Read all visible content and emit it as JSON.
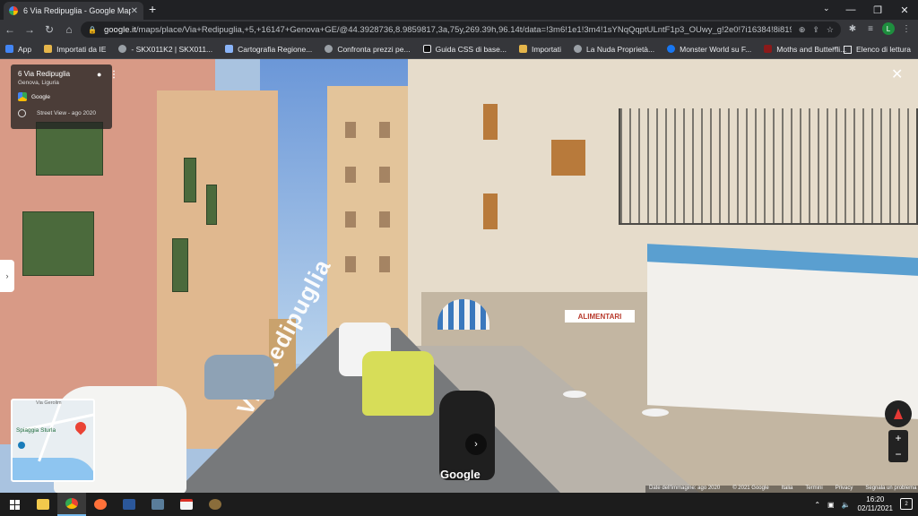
{
  "browser": {
    "tab_title": "6 Via Redipuglia - Google Maps",
    "new_tab": "+",
    "url_host": "google.it",
    "url_path": "/maps/place/Via+Redipuglia,+5,+16147+Genova+GE/@44.3928736,8.9859817,3a,75y,269.39h,96.14t/data=!3m6!1e1!3m4!1sYNqQqptULntF1p3_OUwy_g!2e0!7i16384!8i8192!4m5!3m4!1s0x12d3...",
    "profile_initial": "L",
    "window_controls": [
      "—",
      "❐",
      "✕"
    ]
  },
  "bookmarks": [
    {
      "label": "App",
      "color": "#4285f4"
    },
    {
      "label": "Importati da IE",
      "color": "#e5b54a"
    },
    {
      "label": "- SKX011K2 | SKX011...",
      "color": "#9aa0a6"
    },
    {
      "label": "Cartografia Regione...",
      "color": "#8ab4f8"
    },
    {
      "label": "Confronta prezzi pe...",
      "color": "#9aa0a6"
    },
    {
      "label": "Guida CSS di base...",
      "color": "#202124"
    },
    {
      "label": "Importati",
      "color": "#e5b54a"
    },
    {
      "label": "La Nuda Proprietà...",
      "color": "#9aa0a6"
    },
    {
      "label": "Monster World su F...",
      "color": "#1877f2"
    },
    {
      "label": "Moths and Butterfli...",
      "color": "#8b1a1a"
    }
  ],
  "reading_list": "Elenco di lettura",
  "maps": {
    "place_title": "6 Via Redipuglia",
    "place_subtitle": "Genova, Liguria",
    "provider": "Google",
    "street_view_date": "Street View - ago 2020",
    "street_label": "Via Redipuglia",
    "shop_sign": "ALIMENTARI",
    "minimap_label": "Spiaggia Sturla",
    "minimap_street": "Via Gerolim",
    "google_logo": "Google",
    "footer": [
      "Date dell'immagine: ago 2020",
      "© 2021 Google",
      "Italia",
      "Termini",
      "Privacy",
      "Segnala un problema"
    ]
  },
  "taskbar": {
    "time": "16:20",
    "date": "02/11/2021"
  }
}
